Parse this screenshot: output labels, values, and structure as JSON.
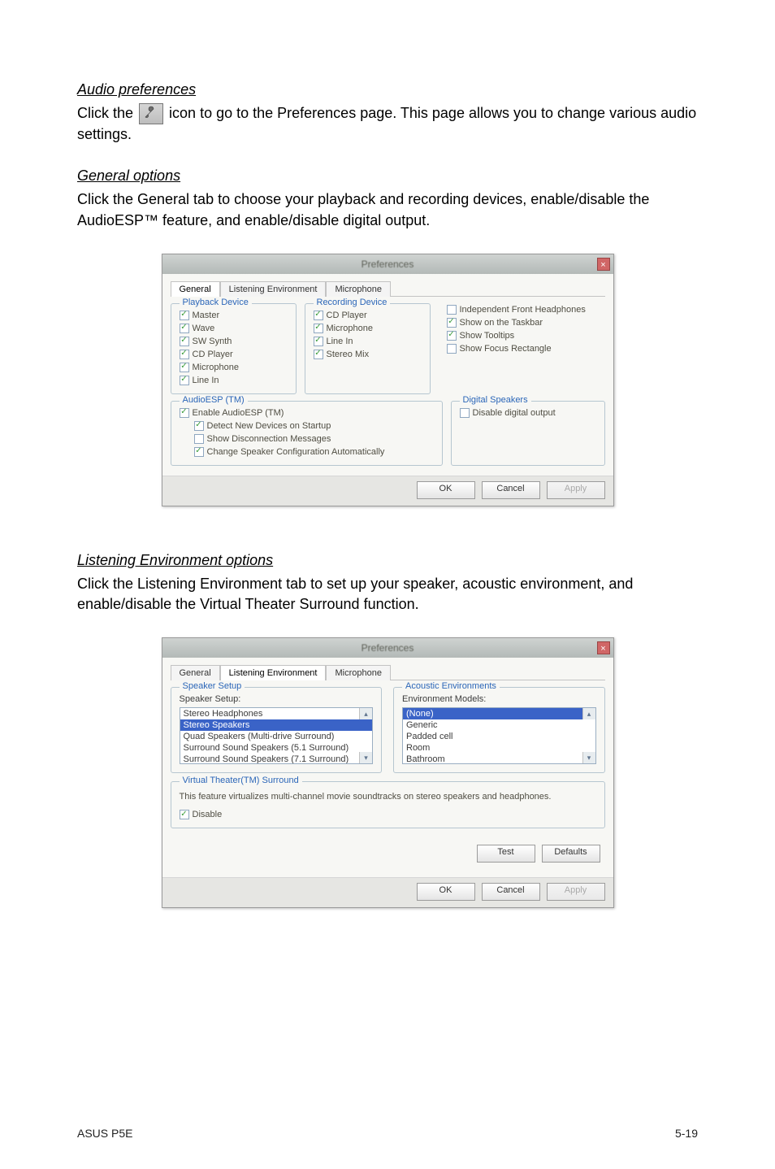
{
  "sections": {
    "audio_prefs": {
      "heading": "Audio preferences",
      "text_before_icon": "Click the ",
      "text_after_icon": " icon to go to the Preferences page. This page allows you to change various audio settings."
    },
    "general_opts": {
      "heading": "General options",
      "text": "Click the General tab to choose your playback and recording devices, enable/disable the AudioESP™ feature, and enable/disable digital output."
    },
    "listening_env": {
      "heading": "Listening Environment options",
      "text": "Click the Listening Environment tab to set up your speaker, acoustic environment, and enable/disable the Virtual Theater Surround function."
    }
  },
  "dialog_common": {
    "title": "Preferences",
    "close_glyph": "×",
    "tabs": {
      "general": "General",
      "listening": "Listening Environment",
      "mic": "Microphone"
    },
    "buttons": {
      "ok": "OK",
      "cancel": "Cancel",
      "apply": "Apply",
      "test": "Test",
      "defaults": "Defaults"
    }
  },
  "dialog1": {
    "groups": {
      "playback": {
        "legend": "Playback Device",
        "items": [
          "Master",
          "Wave",
          "SW Synth",
          "CD Player",
          "Microphone",
          "Line In"
        ]
      },
      "recording": {
        "legend": "Recording Device",
        "items": [
          "CD Player",
          "Microphone",
          "Line In",
          "Stereo Mix"
        ]
      },
      "right": {
        "items": [
          "Independent Front Headphones",
          "Show on the Taskbar",
          "Show Tooltips",
          "Show Focus Rectangle"
        ],
        "checked_idx": [
          1,
          2
        ]
      },
      "audioesp": {
        "legend": "AudioESP (TM)",
        "enable": "Enable AudioESP (TM)",
        "subs": [
          "Detect New Devices on Startup",
          "Show Disconnection Messages",
          "Change Speaker Configuration Automatically"
        ],
        "subs_checked": [
          0,
          2
        ]
      },
      "digital": {
        "legend": "Digital Speakers",
        "item": "Disable digital output"
      }
    }
  },
  "dialog2": {
    "speaker_setup": {
      "legend": "Speaker Setup",
      "label": "Speaker Setup:",
      "items": [
        "Stereo Headphones",
        "Stereo Speakers",
        "Quad Speakers (Multi-drive Surround)",
        "Surround Sound Speakers (5.1 Surround)",
        "Surround Sound Speakers (7.1 Surround)"
      ]
    },
    "acoustic": {
      "legend": "Acoustic Environments",
      "label": "Environment Models:",
      "items": [
        "(None)",
        "Generic",
        "Padded cell",
        "Room",
        "Bathroom"
      ]
    },
    "virtual": {
      "legend": "Virtual Theater(TM) Surround",
      "desc": "This feature virtualizes multi-channel movie soundtracks on stereo speakers and headphones.",
      "disable": "Disable"
    }
  },
  "footer": {
    "left": "ASUS P5E",
    "right": "5-19"
  }
}
